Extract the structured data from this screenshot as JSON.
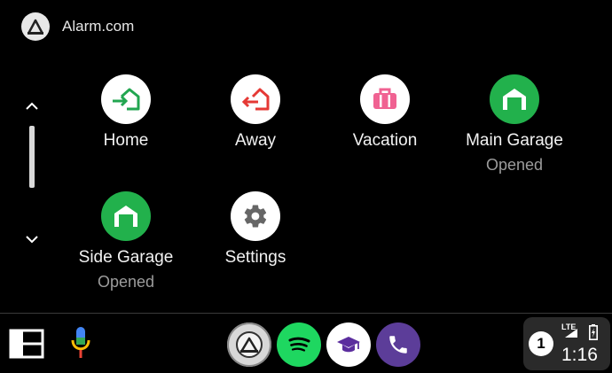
{
  "app": {
    "title": "Alarm.com",
    "logo_icon": "alarm-com-logo-icon"
  },
  "tiles": [
    {
      "label": "Home",
      "sub": "",
      "icon": "home-arrive-icon",
      "color": "#22a650"
    },
    {
      "label": "Away",
      "sub": "",
      "icon": "away-leave-icon",
      "color": "#e53935"
    },
    {
      "label": "Vacation",
      "sub": "",
      "icon": "suitcase-icon",
      "color": "#f06292"
    },
    {
      "label": "Main Garage",
      "sub": "Opened",
      "icon": "garage-open-icon",
      "color": "#22b14c"
    },
    {
      "label": "Side Garage",
      "sub": "Opened",
      "icon": "garage-open-icon",
      "color": "#22b14c"
    },
    {
      "label": "Settings",
      "sub": "",
      "icon": "gear-icon",
      "color": "#666666"
    }
  ],
  "dock": {
    "apps": [
      {
        "name": "Alarm.com",
        "icon": "alarm-com-icon"
      },
      {
        "name": "Spotify",
        "icon": "spotify-icon",
        "color": "#1ed760"
      },
      {
        "name": "Education",
        "icon": "graduation-cap-icon",
        "color": "#5b2d9e"
      },
      {
        "name": "Phone",
        "icon": "phone-icon",
        "color": "#5c3d99"
      }
    ]
  },
  "status": {
    "notification_count": "1",
    "network": "LTE",
    "time": "1:16"
  }
}
